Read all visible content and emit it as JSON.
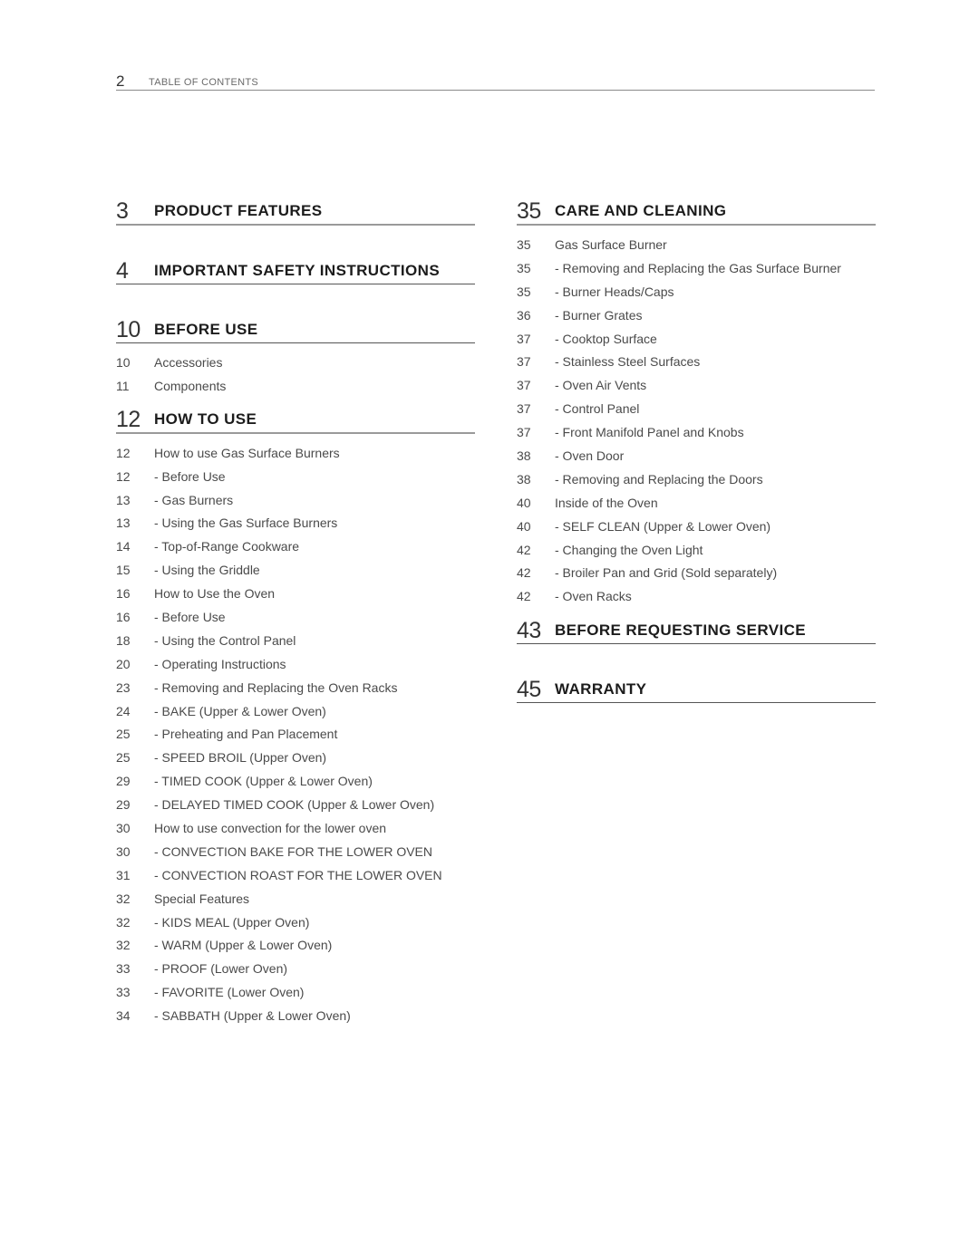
{
  "header": {
    "page_number": "2",
    "title": "TABLE OF CONTENTS"
  },
  "left_column": {
    "sections": [
      {
        "page": "3",
        "title": "PRODUCT FEATURES",
        "entries": []
      },
      {
        "page": "4",
        "title": "IMPORTANT SAFETY INSTRUCTIONS",
        "entries": []
      },
      {
        "page": "10",
        "title": "BEFORE USE",
        "entries": [
          {
            "page": "10",
            "label": "Accessories"
          },
          {
            "page": "11",
            "label": "Components"
          }
        ]
      },
      {
        "page": "12",
        "title": "HOW TO USE",
        "entries": [
          {
            "page": "12",
            "label": "How to use Gas Surface Burners"
          },
          {
            "page": "12",
            "label": "- Before Use"
          },
          {
            "page": "13",
            "label": "- Gas Burners"
          },
          {
            "page": "13",
            "label": "- Using the Gas Surface Burners"
          },
          {
            "page": "14",
            "label": "- Top-of-Range Cookware"
          },
          {
            "page": "15",
            "label": "- Using the Griddle"
          },
          {
            "page": "16",
            "label": "How to Use the Oven"
          },
          {
            "page": "16",
            "label": "- Before Use"
          },
          {
            "page": "18",
            "label": "- Using the Control Panel"
          },
          {
            "page": "20",
            "label": "- Operating Instructions"
          },
          {
            "page": "23",
            "label": "- Removing and Replacing the Oven Racks"
          },
          {
            "page": "24",
            "label": "- BAKE (Upper & Lower Oven)"
          },
          {
            "page": "25",
            "label": "- Preheating and Pan Placement"
          },
          {
            "page": "25",
            "label": "- SPEED BROIL (Upper Oven)"
          },
          {
            "page": "29",
            "label": "- TIMED COOK (Upper & Lower Oven)"
          },
          {
            "page": "29",
            "label": "- DELAYED TIMED COOK (Upper & Lower Oven)"
          },
          {
            "page": "30",
            "label": "How to use convection for the lower oven"
          },
          {
            "page": "30",
            "label": "- CONVECTION BAKE FOR THE LOWER OVEN"
          },
          {
            "page": "31",
            "label": "- CONVECTION ROAST FOR THE LOWER OVEN"
          },
          {
            "page": "32",
            "label": "Special Features"
          },
          {
            "page": "32",
            "label": "- KIDS MEAL (Upper Oven)"
          },
          {
            "page": "32",
            "label": "- WARM (Upper & Lower Oven)"
          },
          {
            "page": "33",
            "label": "- PROOF (Lower Oven)"
          },
          {
            "page": "33",
            "label": "- FAVORITE (Lower Oven)"
          },
          {
            "page": "34",
            "label": "- SABBATH (Upper & Lower Oven)"
          }
        ]
      }
    ]
  },
  "right_column": {
    "sections": [
      {
        "page": "35",
        "title": "CARE AND CLEANING",
        "entries": [
          {
            "page": "35",
            "label": "Gas Surface Burner"
          },
          {
            "page": "35",
            "label": "- Removing and Replacing the Gas Surface Burner"
          },
          {
            "page": "35",
            "label": "- Burner Heads/Caps"
          },
          {
            "page": "36",
            "label": "- Burner Grates"
          },
          {
            "page": "37",
            "label": "- Cooktop Surface"
          },
          {
            "page": "37",
            "label": "- Stainless Steel Surfaces"
          },
          {
            "page": "37",
            "label": "- Oven Air Vents"
          },
          {
            "page": "37",
            "label": "- Control Panel"
          },
          {
            "page": "37",
            "label": "- Front Manifold Panel and Knobs"
          },
          {
            "page": "38",
            "label": "- Oven Door"
          },
          {
            "page": "38",
            "label": "- Removing and Replacing the Doors"
          },
          {
            "page": "40",
            "label": "Inside of the Oven"
          },
          {
            "page": "40",
            "label": "- SELF CLEAN (Upper & Lower Oven)"
          },
          {
            "page": "42",
            "label": "- Changing the Oven Light"
          },
          {
            "page": "42",
            "label": "- Broiler Pan and Grid (Sold separately)"
          },
          {
            "page": "42",
            "label": "- Oven Racks"
          }
        ]
      },
      {
        "page": "43",
        "title": "BEFORE REQUESTING SERVICE",
        "entries": []
      },
      {
        "page": "45",
        "title": "WARRANTY",
        "entries": []
      }
    ]
  }
}
